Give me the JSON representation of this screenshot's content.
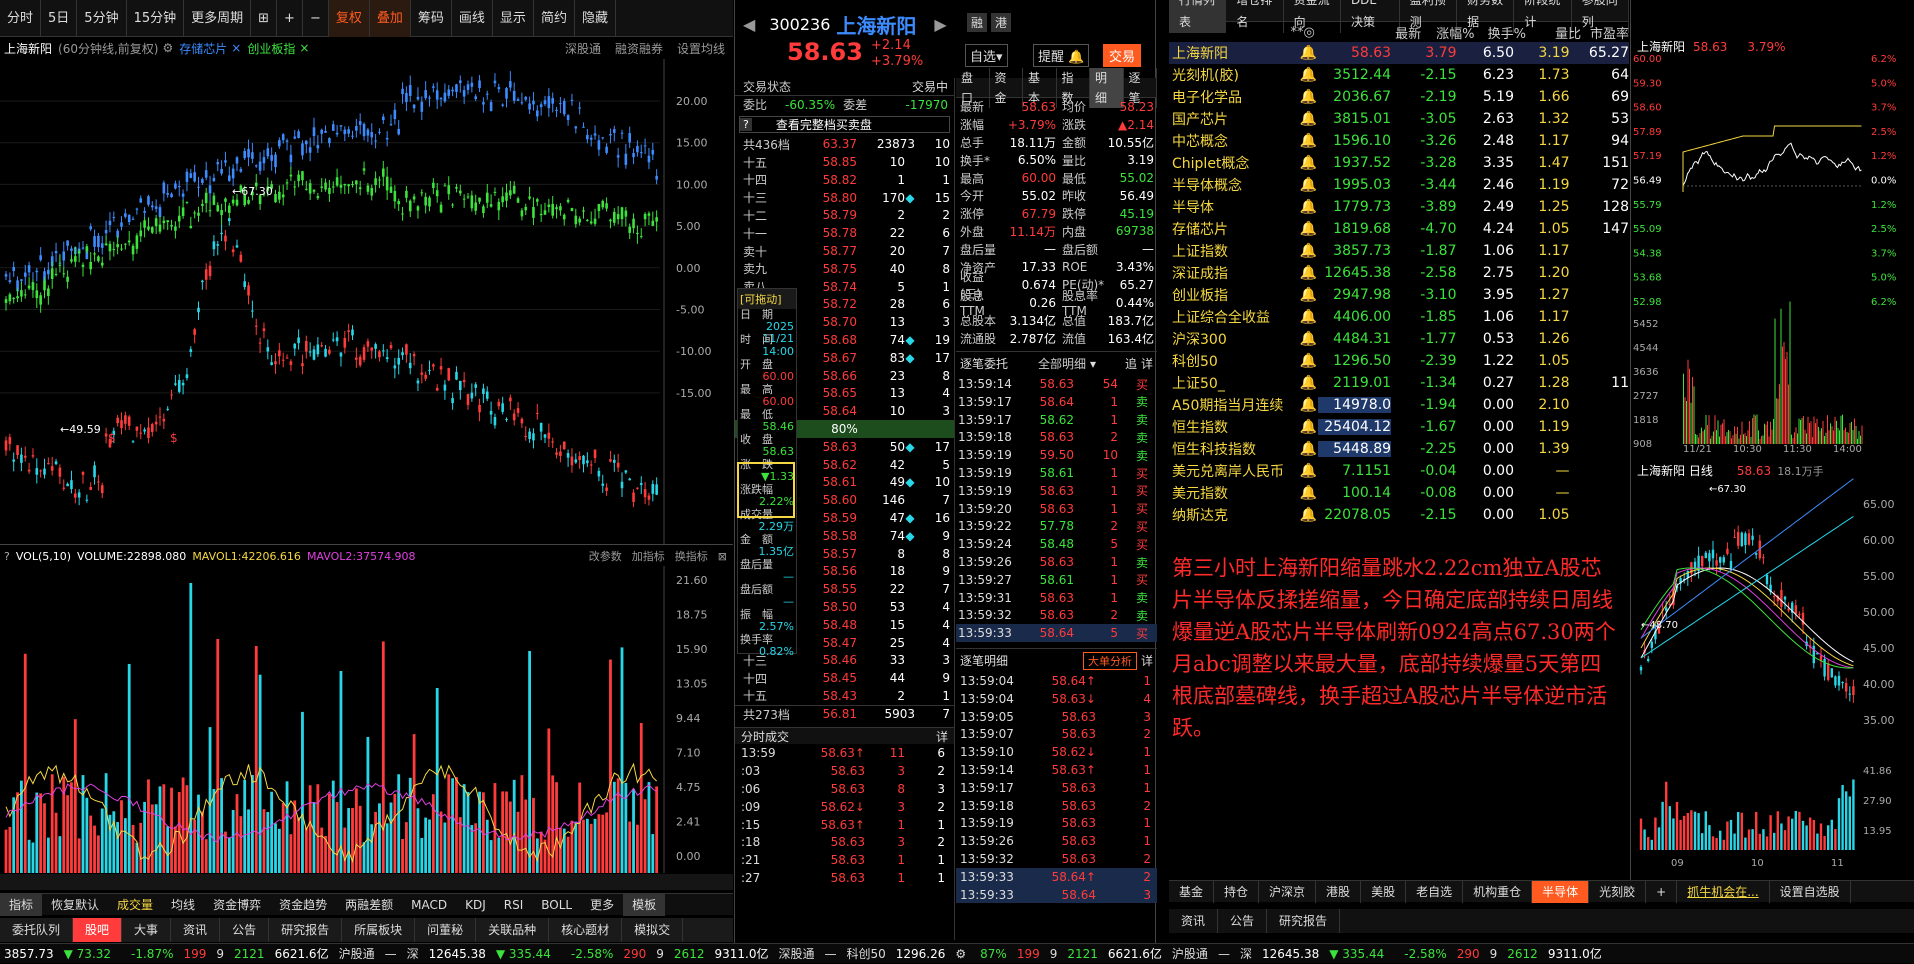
{
  "toolbar": {
    "items": [
      "分时",
      "5日",
      "5分钟",
      "15分钟",
      "更多周期",
      "复权",
      "叠加",
      "筹码",
      "画线",
      "显示",
      "简约",
      "隐藏"
    ]
  },
  "chartbar": {
    "title": "上海新阳",
    "period": "(60分钟线,前复权)",
    "overlay1": "存储芯片",
    "overlay2": "创业板指",
    "right1": "深股通",
    "right2": "融资融券",
    "right3": "设置均线"
  },
  "main_axis": [
    "20.00",
    "15.00",
    "10.00",
    "5.00",
    "0.00",
    "-5.00",
    "-10.00",
    "-15.00"
  ],
  "main_annot": {
    "high": "67.30",
    "low": "49.59"
  },
  "vol": {
    "label": "VOL(5,10)",
    "v": "VOLUME:22898.080",
    "m1": "MAVOL1:42206.616",
    "m2": "MAVOL2:37574.908",
    "btn1": "改参数",
    "btn2": "加指标",
    "btn3": "换指标",
    "axis": [
      "21.60",
      "18.75",
      "15.90",
      "13.05",
      "9.44",
      "7.10",
      "4.75",
      "2.41",
      "0.00"
    ]
  },
  "bottomtabs": [
    "指标",
    "恢复默认",
    "成交量",
    "均线",
    "资金博弈",
    "资金趋势",
    "两融差额",
    "MACD",
    "KDJ",
    "RSI",
    "BOLL",
    "更多",
    "模板"
  ],
  "bottomtabs2": [
    "委托队列",
    "股吧",
    "大事",
    "资讯",
    "公告",
    "研究报告",
    "所属板块",
    "问董秘",
    "关联品种",
    "核心题材",
    "模拟交"
  ],
  "status": {
    "sh_index": "3857.73",
    "sh_chg": "73.32",
    "sh_pct": "-1.87%",
    "up": "199",
    "flat": "9",
    "down": "2121",
    "amt": "6621.6亿",
    "hgt": "沪股通",
    "sz_label": "深",
    "sz_index": "12645.38",
    "sz_chg": "335.44",
    "sz_pct": "-2.58%",
    "sz_up": "290",
    "sz_flat": "9",
    "sz_down": "2612",
    "sz_amt": "9311.0亿",
    "sgt": "深股通",
    "kc": "科创50",
    "kc_val": "1296.26",
    "r_pct": "87%",
    "r_up": "199",
    "r_flat": "9",
    "r_down": "2121",
    "r_amt": "6621.6亿",
    "r_hgt": "沪股通",
    "r_sz": "深",
    "r_sz_index": "12645.38",
    "r_sz_chg": "335.44",
    "r_sz_pct": "-2.58%",
    "r_sz_up": "290",
    "r_sz_flat": "9",
    "r_sz_down": "2612",
    "r_sz_amt": "9311.0亿"
  },
  "quote": {
    "code": "300236",
    "name": "上海新阳",
    "price": "58.63",
    "chg": "+2.14",
    "pct": "+3.79%",
    "btn_zx": "自选",
    "btn_tx": "提醒",
    "btn_jy": "交易",
    "icon1": "融",
    "icon2": "港"
  },
  "ob_head": {
    "status": "交易状态",
    "state": "交易中",
    "wb_lbl": "委比",
    "wb": "-60.35%",
    "wc_lbl": "委差",
    "wc": "-17970",
    "link": "查看完整档买卖盘",
    "sell_total_lbl": "共436档",
    "sell_total_p": "63.37",
    "sell_total_v": "23873",
    "sell_total_c": "10",
    "pct80": "80%",
    "buy_total_lbl": "共273档",
    "buy_total_p": "56.81",
    "buy_total_v": "5903",
    "buy_total_c": "7"
  },
  "sells": [
    {
      "l": "十五",
      "p": "58.85",
      "v": "10",
      "m": "",
      "c": "10"
    },
    {
      "l": "十四",
      "p": "58.82",
      "v": "1",
      "m": "",
      "c": "1"
    },
    {
      "l": "十三",
      "p": "58.80",
      "v": "170",
      "m": "◆",
      "c": "15"
    },
    {
      "l": "十二",
      "p": "58.79",
      "v": "2",
      "m": "",
      "c": "2"
    },
    {
      "l": "十一",
      "p": "58.78",
      "v": "22",
      "m": "",
      "c": "6"
    },
    {
      "l": "卖十",
      "p": "58.77",
      "v": "20",
      "m": "",
      "c": "7"
    },
    {
      "l": "卖九",
      "p": "58.75",
      "v": "40",
      "m": "",
      "c": "8"
    },
    {
      "l": "卖八",
      "p": "58.74",
      "v": "5",
      "m": "",
      "c": "1"
    },
    {
      "l": "卖七",
      "p": "58.72",
      "v": "28",
      "m": "",
      "c": "6"
    },
    {
      "l": "卖六",
      "p": "58.70",
      "v": "13",
      "m": "",
      "c": "3"
    },
    {
      "l": "卖五",
      "p": "58.68",
      "v": "74",
      "m": "◆",
      "c": "19"
    },
    {
      "l": "卖四",
      "p": "58.67",
      "v": "83",
      "m": "◆",
      "c": "17"
    },
    {
      "l": "卖三",
      "p": "58.66",
      "v": "23",
      "m": "",
      "c": "8"
    },
    {
      "l": "卖二",
      "p": "58.65",
      "v": "13",
      "m": "",
      "c": "4"
    },
    {
      "l": "卖一",
      "p": "58.64",
      "v": "10",
      "m": "",
      "c": "3"
    }
  ],
  "buys": [
    {
      "l": "买一",
      "p": "58.63",
      "v": "50",
      "m": "◆",
      "c": "17"
    },
    {
      "l": "买二",
      "p": "58.62",
      "v": "42",
      "m": "",
      "c": "5"
    },
    {
      "l": "买三",
      "p": "58.61",
      "v": "49",
      "m": "◆",
      "c": "10"
    },
    {
      "l": "买四",
      "p": "58.60",
      "v": "146",
      "m": "",
      "c": "7"
    },
    {
      "l": "买五",
      "p": "58.59",
      "v": "47",
      "m": "◆",
      "c": "16"
    },
    {
      "l": "买六",
      "p": "58.58",
      "v": "74",
      "m": "◆",
      "c": "9"
    },
    {
      "l": "买七",
      "p": "58.57",
      "v": "8",
      "m": "",
      "c": "8"
    },
    {
      "l": "买八",
      "p": "58.56",
      "v": "18",
      "m": "",
      "c": "9"
    },
    {
      "l": "买九",
      "p": "58.55",
      "v": "22",
      "m": "",
      "c": "7"
    },
    {
      "l": "买十",
      "p": "58.50",
      "v": "53",
      "m": "",
      "c": "4"
    },
    {
      "l": "十一",
      "p": "58.48",
      "v": "15",
      "m": "",
      "c": "4"
    },
    {
      "l": "十二",
      "p": "58.47",
      "v": "25",
      "m": "",
      "c": "4"
    },
    {
      "l": "十三",
      "p": "58.46",
      "v": "33",
      "m": "",
      "c": "3"
    },
    {
      "l": "十四",
      "p": "58.45",
      "v": "44",
      "m": "",
      "c": "9"
    },
    {
      "l": "十五",
      "p": "58.43",
      "v": "2",
      "m": "",
      "c": "1"
    }
  ],
  "popup": {
    "title": "[可拖动]",
    "date_lbl": "日　期",
    "date": "2025 11/21",
    "time_lbl": "时　间",
    "time": "14:00",
    "open_lbl": "开　盘",
    "open": "60.00",
    "high_lbl": "最　高",
    "high": "60.00",
    "low_lbl": "最　低",
    "low": "58.46",
    "close_lbl": "收　盘",
    "close": "58.63",
    "zd_lbl": "涨　跌",
    "zd": "▼1.33",
    "zdf_lbl": "涨跌幅",
    "zdf": "2.22%",
    "cjl_lbl": "成交量",
    "cjl": "2.29万",
    "je_lbl": "金　额",
    "je": "1.35亿",
    "phl_lbl": "盘后量",
    "phl": "—",
    "phe_lbl": "盘后额",
    "phe": "—",
    "zf_lbl": "振　幅",
    "zf": "2.57%",
    "hsl_lbl": "换手率",
    "hsl": "0.82%"
  },
  "dtabs": [
    "盘口",
    "资金",
    "基本",
    "指数",
    "明细",
    "逐笔"
  ],
  "details": [
    [
      "最新",
      "58.63",
      "均价",
      "58.23"
    ],
    [
      "涨幅",
      "+3.79%",
      "涨跌",
      "▲2.14"
    ],
    [
      "总手",
      "18.11万",
      "金额",
      "10.55亿"
    ],
    [
      "换手*",
      "6.50%",
      "量比",
      "3.19"
    ],
    [
      "最高",
      "60.00",
      "最低",
      "55.02"
    ],
    [
      "今开",
      "55.02",
      "昨收",
      "56.49"
    ],
    [
      "涨停",
      "67.79",
      "跌停",
      "45.19"
    ],
    [
      "外盘",
      "11.14万",
      "内盘",
      "69738"
    ],
    [
      "盘后量",
      "—",
      "盘后额",
      "—"
    ],
    [
      "净资产",
      "17.33",
      "ROE",
      "3.43%"
    ],
    [
      "收益(三)",
      "0.674",
      "PE(动)*",
      "65.27"
    ],
    [
      "股息TTM",
      "0.26",
      "股息率TTM",
      "0.44%"
    ],
    [
      "总股本",
      "3.134亿",
      "总值",
      "183.7亿"
    ],
    [
      "流通股",
      "2.787亿",
      "流值",
      "163.4亿"
    ]
  ],
  "zb": {
    "title": "逐笔委托",
    "sel": "全部明细",
    "b1": "追",
    "b2": "详",
    "rows": [
      [
        "13:59:14",
        "58.63",
        "54",
        "买"
      ],
      [
        "13:59:17",
        "58.64",
        "1",
        "卖"
      ],
      [
        "13:59:17",
        "58.62",
        "1",
        "卖"
      ],
      [
        "13:59:18",
        "58.63",
        "2",
        "卖"
      ],
      [
        "13:59:19",
        "59.50",
        "10",
        "卖"
      ],
      [
        "13:59:19",
        "58.61",
        "1",
        "买"
      ],
      [
        "13:59:19",
        "58.63",
        "1",
        "买"
      ],
      [
        "13:59:20",
        "58.63",
        "1",
        "买"
      ],
      [
        "13:59:22",
        "57.78",
        "2",
        "买"
      ],
      [
        "13:59:24",
        "58.48",
        "5",
        "买"
      ],
      [
        "13:59:26",
        "58.63",
        "1",
        "卖"
      ],
      [
        "13:59:27",
        "58.61",
        "1",
        "买"
      ],
      [
        "13:59:31",
        "58.63",
        "1",
        "卖"
      ],
      [
        "13:59:32",
        "58.63",
        "2",
        "卖"
      ],
      [
        "13:59:33",
        "58.64",
        "5",
        "买"
      ]
    ]
  },
  "fs": {
    "title": "分时成交",
    "btn": "详",
    "rows": [
      [
        "13:59",
        "58.63↑",
        "11",
        "6"
      ],
      [
        ":03",
        "58.63",
        "3",
        "2"
      ],
      [
        ":06",
        "58.63",
        "8",
        "3"
      ],
      [
        ":09",
        "58.62↓",
        "3",
        "2"
      ],
      [
        ":15",
        "58.63↑",
        "1",
        "1"
      ],
      [
        ":18",
        "58.63",
        "3",
        "2"
      ],
      [
        ":21",
        "58.63",
        "1",
        "1"
      ],
      [
        ":27",
        "58.63",
        "1",
        "1"
      ]
    ]
  },
  "zbmx": {
    "title": "逐笔明细",
    "btn": "大单分析",
    "btn2": "详",
    "rows": [
      [
        "13:59:04",
        "58.64↑",
        "1"
      ],
      [
        "13:59:04",
        "58.63↓",
        "4"
      ],
      [
        "13:59:05",
        "58.63",
        "3"
      ],
      [
        "13:59:07",
        "58.63",
        "2"
      ],
      [
        "13:59:10",
        "58.62↓",
        "1"
      ],
      [
        "13:59:14",
        "58.63↑",
        "1"
      ],
      [
        "13:59:17",
        "58.63",
        "1"
      ],
      [
        "13:59:18",
        "58.63",
        "2"
      ],
      [
        "13:59:19",
        "58.63",
        "1"
      ],
      [
        "13:59:26",
        "58.63",
        "1"
      ],
      [
        "13:59:32",
        "58.63",
        "2"
      ],
      [
        "13:59:33",
        "58.64↑",
        "2"
      ],
      [
        "13:59:33",
        "58.64",
        "3"
      ]
    ]
  },
  "rtabs": [
    "行情列表",
    "增仓排名",
    "资金流向",
    "DDE决策",
    "盈利预测",
    "财务数据",
    "阶段统计",
    "参股同列"
  ],
  "rhead": [
    "",
    "**◎",
    "最新",
    "涨幅%",
    "换手%",
    "量比",
    "市盈率"
  ],
  "rlist": [
    [
      "上海新阳",
      "58.63",
      "3.79",
      "6.50",
      "3.19",
      "65.27"
    ],
    [
      "光刻机(胶)",
      "3512.44",
      "-2.15",
      "6.23",
      "1.73",
      "64"
    ],
    [
      "电子化学品",
      "2036.67",
      "-2.19",
      "5.19",
      "1.66",
      "69"
    ],
    [
      "国产芯片",
      "3815.01",
      "-3.05",
      "2.63",
      "1.32",
      "53"
    ],
    [
      "中芯概念",
      "1596.10",
      "-3.26",
      "2.48",
      "1.17",
      "94"
    ],
    [
      "Chiplet概念",
      "1937.52",
      "-3.28",
      "3.35",
      "1.47",
      "151"
    ],
    [
      "半导体概念",
      "1995.03",
      "-3.44",
      "2.46",
      "1.19",
      "72"
    ],
    [
      "半导体",
      "1779.73",
      "-3.89",
      "2.49",
      "1.25",
      "128"
    ],
    [
      "存储芯片",
      "1819.68",
      "-4.70",
      "4.24",
      "1.05",
      "147"
    ],
    [
      "上证指数",
      "3857.73",
      "-1.87",
      "1.06",
      "1.17",
      ""
    ],
    [
      "深证成指",
      "12645.38",
      "-2.58",
      "2.75",
      "1.20",
      ""
    ],
    [
      "创业板指",
      "2947.98",
      "-3.10",
      "3.95",
      "1.27",
      ""
    ],
    [
      "上证综合全收益",
      "4406.00",
      "-1.85",
      "1.06",
      "1.17",
      ""
    ],
    [
      "沪深300",
      "4484.31",
      "-1.77",
      "0.53",
      "1.26",
      ""
    ],
    [
      "科创50",
      "1296.50",
      "-2.39",
      "1.22",
      "1.05",
      ""
    ],
    [
      "上证50_",
      "2119.01",
      "-1.34",
      "0.27",
      "1.28",
      "11"
    ],
    [
      "A50期指当月连续",
      "14978.0",
      "-1.94",
      "0.00",
      "2.10",
      ""
    ],
    [
      "恒生指数",
      "25404.12",
      "-1.67",
      "0.00",
      "1.19",
      ""
    ],
    [
      "恒生科技指数",
      "5448.89",
      "-2.25",
      "0.00",
      "1.39",
      ""
    ],
    [
      "美元兑离岸人民币",
      "7.1151",
      "-0.04",
      "0.00",
      "—",
      ""
    ],
    [
      "美元指数",
      "100.14",
      "-0.08",
      "0.00",
      "—",
      ""
    ],
    [
      "纳斯达克",
      "22078.05",
      "-2.15",
      "0.00",
      "1.05",
      ""
    ]
  ],
  "note": "第三小时上海新阳缩量跳水2.22cm独立A股芯片半导体反揉搓缩量，今日确定底部持续日周线爆量逆A股芯片半导体刷新0924高点67.30两个月abc调整以来最大量，底部持续爆量5天第四根底部墓碑线，换手超过A股芯片半导体逆市活跃。",
  "mini": {
    "name": "上海新阳",
    "price": "58.63",
    "pct": "3.79%",
    "laxis": [
      "60.00",
      "59.30",
      "58.60",
      "57.89",
      "57.19",
      "56.49",
      "55.79",
      "55.09",
      "54.38",
      "53.68",
      "52.98"
    ],
    "raxis": [
      "6.2%",
      "5.0%",
      "3.7%",
      "2.5%",
      "1.2%",
      "0.0%",
      "1.2%",
      "2.5%",
      "3.7%",
      "5.0%",
      "6.2%"
    ],
    "vaxis": [
      "5452",
      "4544",
      "3636",
      "2727",
      "1818",
      "908"
    ],
    "times": [
      "11/21",
      "10:30",
      "11:30",
      "14:00"
    ],
    "day_title": "上海新阳 日线",
    "day_price": "58.63",
    "day_vol": "18.1万手",
    "day_hi": "67.30",
    "day_lo": "48.70",
    "day_axis": [
      "65.00",
      "60.00",
      "55.00",
      "50.00",
      "45.00",
      "40.00",
      "35.00"
    ],
    "day_vaxis": [
      "41.86",
      "27.90",
      "13.95"
    ],
    "months": [
      "09",
      "10",
      "11"
    ]
  },
  "rbtabs": [
    "基金",
    "持仓",
    "沪深京",
    "港股",
    "美股",
    "老自选",
    "机构重仓",
    "半导体",
    "光刻胶",
    "+",
    "抓牛机会在...",
    "设置自选股"
  ],
  "rbtabs2": [
    "资讯",
    "公告",
    "研究报告"
  ]
}
